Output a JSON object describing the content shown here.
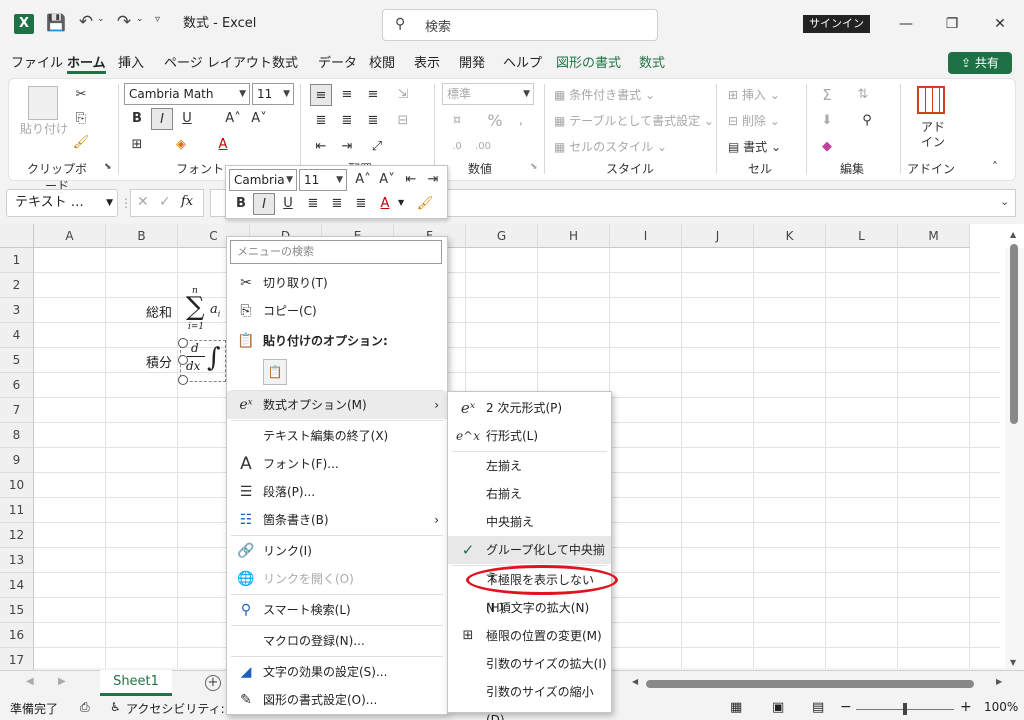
{
  "titlebar": {
    "title": "数式 - Excel",
    "search_placeholder": "検索",
    "signin": "サインイン",
    "minimize": "—",
    "restore": "❐",
    "close": "✕"
  },
  "tabs": [
    {
      "label": "ファイル"
    },
    {
      "label": "ホーム"
    },
    {
      "label": "挿入"
    },
    {
      "label": "ページ レイアウト"
    },
    {
      "label": "数式"
    },
    {
      "label": "データ"
    },
    {
      "label": "校閲"
    },
    {
      "label": "表示"
    },
    {
      "label": "開発"
    },
    {
      "label": "ヘルプ"
    },
    {
      "label": "図形の書式"
    },
    {
      "label": "数式"
    }
  ],
  "share": "共有",
  "ribbon": {
    "clipboard": {
      "label": "クリップボード",
      "paste": "貼り付け"
    },
    "font": {
      "label": "フォント",
      "name": "Cambria Math",
      "size": "11"
    },
    "alignment": {
      "label": "配置"
    },
    "number": {
      "label": "数値",
      "format": "標準"
    },
    "styles": {
      "label": "スタイル",
      "conditional": "条件付き書式",
      "table": "テーブルとして書式設定",
      "cell": "セルのスタイル"
    },
    "cells": {
      "label": "セル",
      "insert": "挿入",
      "delete": "削除",
      "format": "書式"
    },
    "editing": {
      "label": "編集"
    },
    "addins": {
      "label": "アドイン",
      "button": "アド\nイン"
    }
  },
  "formula_bar": {
    "name_box": "テキスト …",
    "fx": "fx"
  },
  "columns": [
    "A",
    "B",
    "C",
    "D",
    "E",
    "F",
    "G",
    "H",
    "I",
    "J",
    "K",
    "L",
    "M"
  ],
  "rows": [
    "1",
    "2",
    "3",
    "4",
    "5",
    "6",
    "7",
    "8",
    "9",
    "10",
    "11",
    "12",
    "13",
    "14",
    "15",
    "16",
    "17"
  ],
  "cells": {
    "b3": "総和",
    "b5": "積分"
  },
  "mini_toolbar": {
    "font": "Cambria",
    "size": "11"
  },
  "context_menu": {
    "search_placeholder": "メニューの検索",
    "items": [
      {
        "label": "切り取り(T)"
      },
      {
        "label": "コピー(C)"
      },
      {
        "label": "貼り付けのオプション:"
      },
      {
        "label": "数式オプション(M)"
      },
      {
        "label": "テキスト編集の終了(X)"
      },
      {
        "label": "フォント(F)..."
      },
      {
        "label": "段落(P)..."
      },
      {
        "label": "箇条書き(B)"
      },
      {
        "label": "リンク(I)"
      },
      {
        "label": "リンクを開く(O)"
      },
      {
        "label": "スマート検索(L)"
      },
      {
        "label": "マクロの登録(N)..."
      },
      {
        "label": "文字の効果の設定(S)..."
      },
      {
        "label": "図形の書式設定(O)..."
      }
    ]
  },
  "submenu": {
    "items": [
      {
        "label": "2 次元形式(P)"
      },
      {
        "label": "行形式(L)"
      },
      {
        "label": "左揃え"
      },
      {
        "label": "右揃え"
      },
      {
        "label": "中央揃え"
      },
      {
        "label": "グループ化して中央揃え"
      },
      {
        "label": "下極限を表示しない(H)"
      },
      {
        "label": "N 項文字の拡大(N)"
      },
      {
        "label": "極限の位置の変更(M)"
      },
      {
        "label": "引数のサイズの拡大(I)"
      },
      {
        "label": "引数のサイズの縮小(D)"
      }
    ]
  },
  "sheet_tab": "Sheet1",
  "status": {
    "ready": "準備完了",
    "accessibility": "アクセシビリティ: 問題",
    "zoom": "100%"
  },
  "colors": {
    "accent": "#217346",
    "highlight_oval": "#e0141e"
  }
}
